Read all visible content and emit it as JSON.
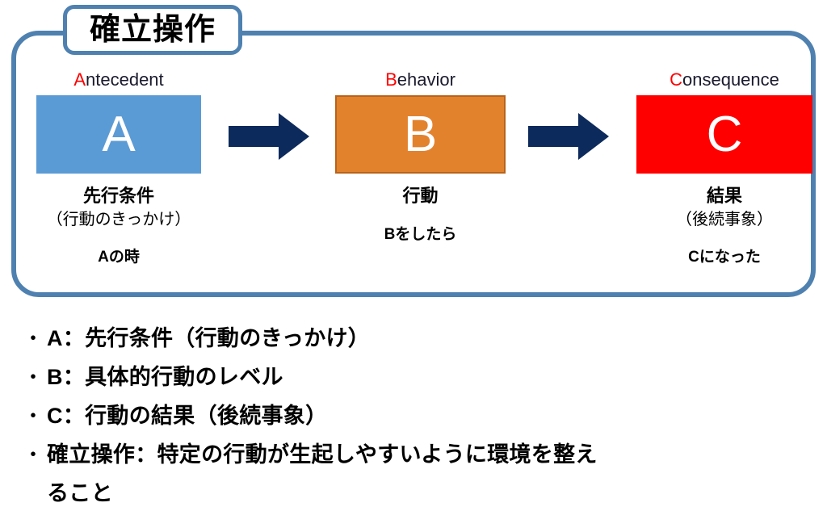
{
  "diagram": {
    "title_badge": "確立操作",
    "columns": [
      {
        "english_label_initial": "A",
        "english_label_rest": "ntecedent",
        "letter": "A",
        "box_color": "#5B9BD5",
        "jp_main": "先行条件",
        "jp_sub": "（行動のきっかけ）",
        "jp_phrase": "Aの時"
      },
      {
        "english_label_initial": "B",
        "english_label_rest": "ehavior",
        "letter": "B",
        "box_color": "#E3822D",
        "jp_main": "行動",
        "jp_sub": "",
        "jp_phrase": "Bをしたら"
      },
      {
        "english_label_initial": "C",
        "english_label_rest": "onsequence",
        "letter": "C",
        "box_color": "#FF0000",
        "jp_main": "結果",
        "jp_sub": "（後続事象）",
        "jp_phrase": "Cになった"
      }
    ],
    "arrows": [
      {
        "name": "arrow-a-to-b",
        "color": "#0D2A5C"
      },
      {
        "name": "arrow-b-to-c",
        "color": "#0D2A5C"
      }
    ],
    "frame_color": "#4E81B0"
  },
  "bullets": [
    {
      "marker": "・",
      "text": "A：先行条件（行動のきっかけ）",
      "continuation": ""
    },
    {
      "marker": "・",
      "text": "B：具体的行動のレベル",
      "continuation": ""
    },
    {
      "marker": "・",
      "text": "C：行動の結果（後続事象）",
      "continuation": ""
    },
    {
      "marker": "・",
      "text": "確立操作：特定の行動が生起しやすいように環境を整え",
      "continuation": "ること"
    }
  ]
}
